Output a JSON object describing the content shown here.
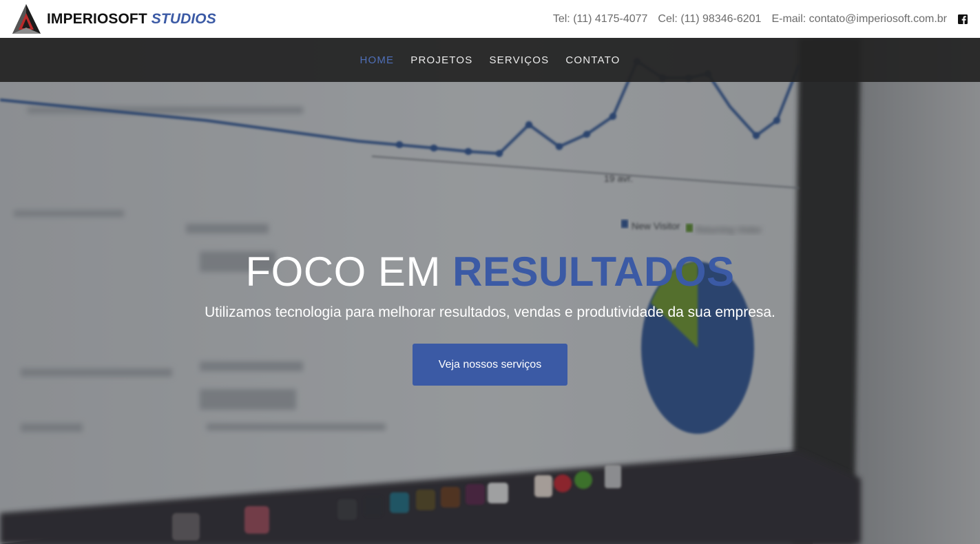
{
  "brand": {
    "name_main": "IMPERIOSOFT",
    "name_accent": "STUDIOS",
    "logo_icon": "triangle-logo-icon",
    "accent_color": "#3b5aa5"
  },
  "contacts": {
    "tel": "Tel: (11) 4175-4077",
    "cel": "Cel: (11) 98346-6201",
    "email": "E-mail: contato@imperiosoft.com.br",
    "social_icon": "facebook-icon"
  },
  "nav": {
    "items": [
      {
        "label": "HOME",
        "active": true
      },
      {
        "label": "PROJETOS",
        "active": false
      },
      {
        "label": "SERVIÇOS",
        "active": false
      },
      {
        "label": "CONTATO",
        "active": false
      }
    ]
  },
  "hero": {
    "title_plain": "FOCO EM",
    "title_accent": "RESULTADOS",
    "subtitle": "Utilizamos tecnologia para melhorar resultados, vendas e produtividade da sua empresa.",
    "button_label": "Veja nossos serviços",
    "background": "blurred-laptop-analytics-image",
    "bg_chart_label": "19 avr.",
    "bg_legend_new": "New Visitor",
    "bg_legend_returning": "Returning Visitor"
  }
}
